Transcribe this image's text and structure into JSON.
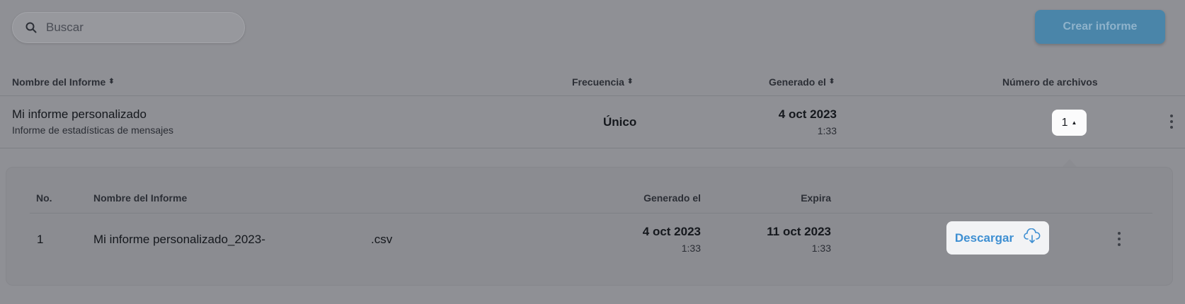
{
  "search": {
    "placeholder": "Buscar"
  },
  "toolbar": {
    "create_label": "Crear informe"
  },
  "table": {
    "headers": {
      "name": "Nombre del Informe",
      "frequency": "Frecuencia",
      "generated": "Generado el",
      "files": "Número de archivos"
    },
    "rows": [
      {
        "title": "Mi informe personalizado",
        "subtitle": "Informe de estadísticas de mensajes",
        "frequency": "Único",
        "generated_date": "4 oct 2023",
        "generated_time": "1:33",
        "file_count": "1"
      }
    ]
  },
  "files_panel": {
    "headers": {
      "no": "No.",
      "name": "Nombre del Informe",
      "generated": "Generado el",
      "expires": "Expira"
    },
    "rows": [
      {
        "no": "1",
        "name": "Mi informe personalizado_2023-",
        "ext": ".csv",
        "generated_date": "4 oct 2023",
        "generated_time": "1:33",
        "expires_date": "11 oct 2023",
        "expires_time": "1:33",
        "download_label": "Descargar"
      }
    ]
  },
  "colors": {
    "accent": "#3e8fd2",
    "overlay": "#8f9095"
  },
  "icons": [
    "search-icon",
    "sort-icon",
    "caret-up-icon",
    "kebab-icon",
    "cloud-download-icon"
  ]
}
